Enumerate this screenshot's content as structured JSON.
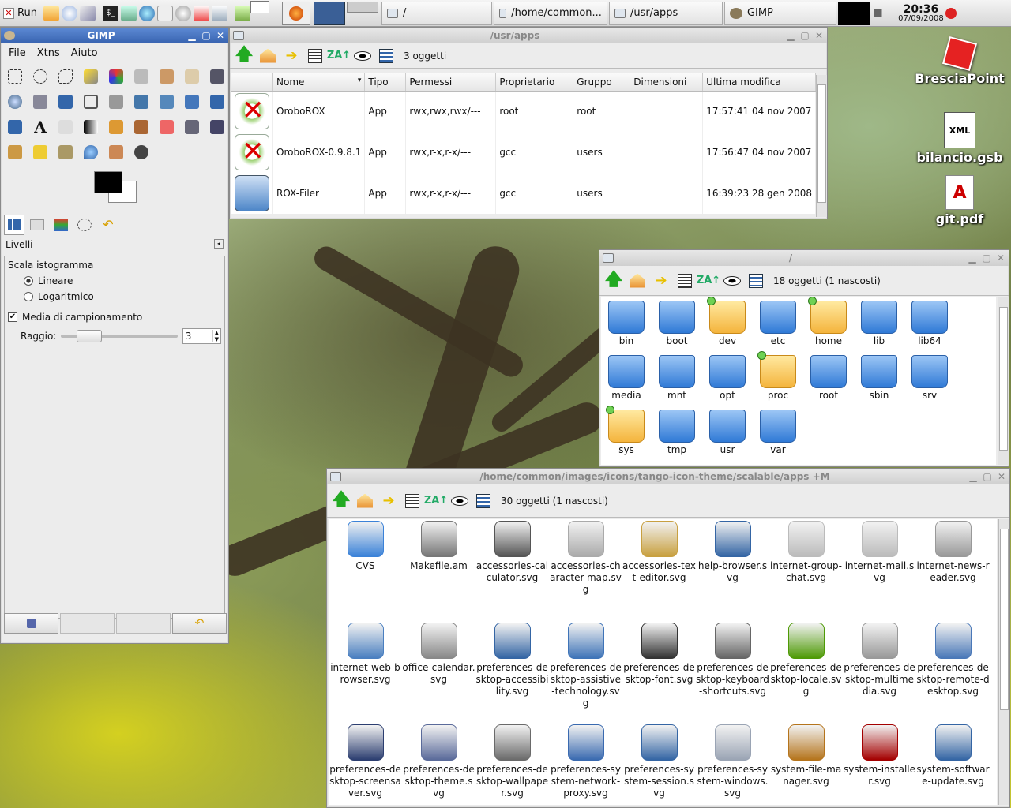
{
  "taskbar": {
    "run_label": "Run",
    "tasks": [
      {
        "label": "/"
      },
      {
        "label": "/home/common..."
      },
      {
        "label": "/usr/apps"
      },
      {
        "label": "GIMP"
      }
    ],
    "clock_time": "20:36",
    "clock_date": "07/09/2008"
  },
  "desktop_icons": [
    {
      "label": "BresciaPoint"
    },
    {
      "label": "bilancio.gsb"
    },
    {
      "label": "git.pdf"
    }
  ],
  "gimp": {
    "title": "GIMP",
    "menu": [
      "File",
      "Xtns",
      "Aiuto"
    ],
    "panel_title": "Livelli",
    "scala_label": "Scala istogramma",
    "lineare": "Lineare",
    "logaritmico": "Logaritmico",
    "media": "Media di campionamento",
    "raggio_label": "Raggio:",
    "raggio_value": "3"
  },
  "usr_apps": {
    "title": "/usr/apps",
    "count": "3 oggetti",
    "columns": [
      "Nome",
      "Tipo",
      "Permessi",
      "Proprietario",
      "Gruppo",
      "Dimensioni",
      "Ultima modifica"
    ],
    "rows": [
      {
        "name": "OroboROX",
        "type": "App",
        "perm": "rwx,rwx,rwx/---",
        "owner": "root",
        "group": "root",
        "size": "",
        "mod": "17:57:41 04 nov 2007"
      },
      {
        "name": "OroboROX-0.9.8.1",
        "type": "App",
        "perm": "rwx,r-x,r-x/---",
        "owner": "gcc",
        "group": "users",
        "size": "",
        "mod": "17:56:47 04 nov 2007"
      },
      {
        "name": "ROX-Filer",
        "type": "App",
        "perm": "rwx,r-x,r-x/---",
        "owner": "gcc",
        "group": "users",
        "size": "",
        "mod": "16:39:23 28 gen 2008"
      }
    ]
  },
  "root_win": {
    "title": "/",
    "count": "18 oggetti (1 nascosti)",
    "items": [
      {
        "label": "bin",
        "yellow": false
      },
      {
        "label": "boot",
        "yellow": false
      },
      {
        "label": "dev",
        "yellow": true
      },
      {
        "label": "etc",
        "yellow": false
      },
      {
        "label": "home",
        "yellow": true
      },
      {
        "label": "lib",
        "yellow": false
      },
      {
        "label": "lib64",
        "yellow": false
      },
      {
        "label": "media",
        "yellow": false
      },
      {
        "label": "mnt",
        "yellow": false
      },
      {
        "label": "opt",
        "yellow": false
      },
      {
        "label": "proc",
        "yellow": true
      },
      {
        "label": "root",
        "yellow": false
      },
      {
        "label": "sbin",
        "yellow": false
      },
      {
        "label": "srv",
        "yellow": false
      },
      {
        "label": "sys",
        "yellow": true
      },
      {
        "label": "tmp",
        "yellow": false
      },
      {
        "label": "usr",
        "yellow": false
      },
      {
        "label": "var",
        "yellow": false
      }
    ]
  },
  "tango_win": {
    "title": "/home/common/images/icons/tango-icon-theme/scalable/apps +M",
    "count": "30 oggetti (1 nascosti)",
    "items": [
      {
        "label": "CVS",
        "color": "#3b82d8"
      },
      {
        "label": "Makefile.am",
        "color": "#777777"
      },
      {
        "label": "accessories-calculator.svg",
        "color": "#555555"
      },
      {
        "label": "accessories-character-map.svg",
        "color": "#aaaaaa"
      },
      {
        "label": "accessories-text-editor.svg",
        "color": "#c8a040"
      },
      {
        "label": "help-browser.svg",
        "color": "#3465a4"
      },
      {
        "label": "internet-group-chat.svg",
        "color": "#bbbbbb"
      },
      {
        "label": "internet-mail.svg",
        "color": "#bbbbbb"
      },
      {
        "label": "internet-news-reader.svg",
        "color": "#999999"
      },
      {
        "label": "internet-web-browser.svg",
        "color": "#4a7fc0"
      },
      {
        "label": "office-calendar.svg",
        "color": "#888888"
      },
      {
        "label": "preferences-desktop-accessibility.svg",
        "color": "#3465a4"
      },
      {
        "label": "preferences-desktop-assistive-technology.svg",
        "color": "#3f74b8"
      },
      {
        "label": "preferences-desktop-font.svg",
        "color": "#333333"
      },
      {
        "label": "preferences-desktop-keyboard-shortcuts.svg",
        "color": "#666666"
      },
      {
        "label": "preferences-desktop-locale.svg",
        "color": "#4e9a06"
      },
      {
        "label": "preferences-desktop-multimedia.svg",
        "color": "#999999"
      },
      {
        "label": "preferences-desktop-remote-desktop.svg",
        "color": "#4a78b8"
      },
      {
        "label": "preferences-desktop-screensaver.svg",
        "color": "#2c3e70"
      },
      {
        "label": "preferences-desktop-theme.svg",
        "color": "#5a6a9a"
      },
      {
        "label": "preferences-desktop-wallpaper.svg",
        "color": "#6a6a6a"
      },
      {
        "label": "preferences-system-network-proxy.svg",
        "color": "#3a6ab0"
      },
      {
        "label": "preferences-system-session.svg",
        "color": "#3465a4"
      },
      {
        "label": "preferences-system-windows.svg",
        "color": "#9aa4b4"
      },
      {
        "label": "system-file-manager.svg",
        "color": "#b5741c"
      },
      {
        "label": "system-installer.svg",
        "color": "#a40000"
      },
      {
        "label": "system-software-update.svg",
        "color": "#3465a4"
      }
    ]
  }
}
